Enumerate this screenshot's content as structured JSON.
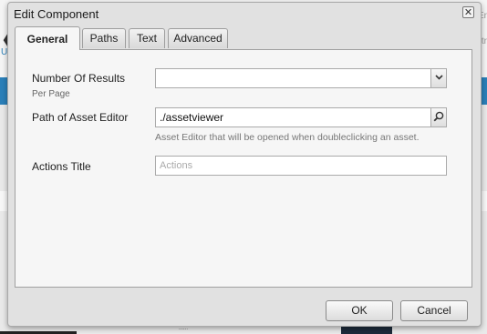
{
  "background": {
    "back_glyph": "❮",
    "u_text": "U",
    "right_text_1": "Er",
    "right_text_2": "tr",
    "thumb_text": "......"
  },
  "dialog": {
    "title": "Edit Component",
    "close_glyph": "✕",
    "tabs": [
      {
        "label": "General",
        "active": true
      },
      {
        "label": "Paths",
        "active": false
      },
      {
        "label": "Text",
        "active": false
      },
      {
        "label": "Advanced",
        "active": false
      }
    ],
    "fields": {
      "results": {
        "label": "Number Of Results",
        "sublabel": "Per Page",
        "value": "",
        "icon": "chevron-down-icon"
      },
      "asset_editor": {
        "label": "Path of Asset Editor",
        "value": "./assetviewer",
        "help": "Asset Editor that will be opened when doubleclicking an asset.",
        "icon": "search-icon"
      },
      "actions_title": {
        "label": "Actions Title",
        "placeholder": "Actions"
      }
    },
    "buttons": {
      "ok": "OK",
      "cancel": "Cancel"
    }
  }
}
